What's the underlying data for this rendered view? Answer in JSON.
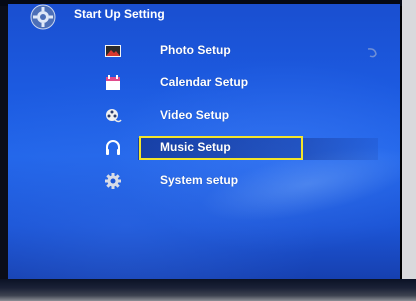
{
  "header": {
    "title": "Start Up Setting",
    "icon": "settings-gear-icon"
  },
  "menu": {
    "items": [
      {
        "label": "Photo Setup",
        "icon": "photo-icon",
        "selected": false
      },
      {
        "label": "Calendar Setup",
        "icon": "calendar-icon",
        "selected": false
      },
      {
        "label": "Video Setup",
        "icon": "video-reel-icon",
        "selected": false
      },
      {
        "label": "Music Setup",
        "icon": "headphones-icon",
        "selected": true
      },
      {
        "label": "System setup",
        "icon": "gear-icon",
        "selected": false
      }
    ]
  },
  "colors": {
    "background": "#1c5ae0",
    "selection_border": "#f3e52a",
    "text": "#ffffff"
  }
}
